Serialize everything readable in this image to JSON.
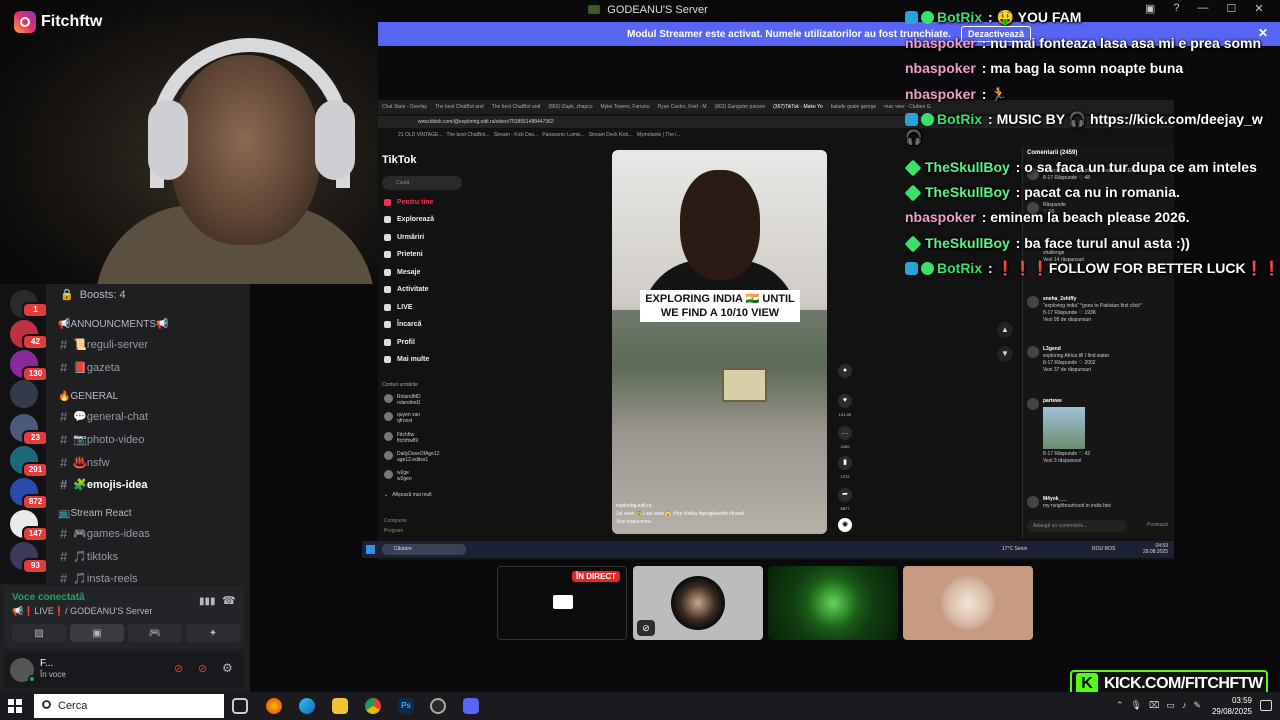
{
  "webcam": {
    "brand_name": "Fitchftw"
  },
  "window": {
    "title": "GODEANU'S Server"
  },
  "streamer_bar": {
    "message": "Modul Streamer este activat. Numele utilizatorilor au fost trunchiate.",
    "button": "Dezactivează"
  },
  "discord": {
    "boosts": "Boosts: 4",
    "server_badges": [
      "1",
      "42",
      "130",
      "23",
      "291",
      "872",
      "147",
      "93"
    ],
    "categories": [
      "📢ANNOUNCMENTS📢",
      "🔥GENERAL",
      "📺Stream React"
    ],
    "channels": [
      "📜reguli-server",
      "📕gazeta",
      "💬general-chat",
      "📷photo-video",
      "♨️nsfw",
      "🧩emojis-idea",
      "🎮games-ideas",
      "🎵tiktoks",
      "🎵insta-reels"
    ],
    "voice_status": "Voce conectată",
    "voice_server": "📢❗LIVE❗/ GODEANU'S Server",
    "user_name": "F...",
    "user_sub": "În voce"
  },
  "browser": {
    "tabs": [
      "Chat Stats - Overlay",
      "The best ChatBot and",
      "The best ChatBot and",
      "(863) iZapk, zhapco",
      "Myke Towers, Farruko",
      "Ryan Castro, Feid - M",
      "(863) Gangster paruon",
      "(367)TikTok - Make Yo",
      "balade goale george",
      "mac veer - Ciufare G"
    ],
    "url": "www.tiktok.com/@exploring.edit.ra/video/7538551488447362",
    "bookmarks": [
      "21 OLD VINTAGE...",
      "The best ChatBot...",
      "Stream - Kick Das...",
      "Panasonic Lumix...",
      "Stream Deck Kick...",
      "Mymotants | The i..."
    ],
    "tiktok_logo": "TikTok",
    "search_placeholder": "Caută",
    "nav": [
      "Pentru tine",
      "Explorează",
      "Urmăriri",
      "Prieteni",
      "Mesaje",
      "Activitate",
      "LIVE",
      "Încarcă",
      "Profil",
      "Mai multe"
    ],
    "following_header": "Conturi urmărite",
    "accounts": [
      {
        "name": "RolandMD",
        "handle": "rolandmd1"
      },
      {
        "name": "quyen van",
        "handle": "qfroost"
      },
      {
        "name": "Fitchftw",
        "handle": "fitchftw89"
      },
      {
        "name": "DailyDoseOfAge12",
        "handle": "age12.editss1"
      },
      {
        "name": "w2ge",
        "handle": "w2geo"
      }
    ],
    "show_more": "Afișează mai mult",
    "footer": [
      "Companie",
      "Program"
    ],
    "video_caption": "EXPLORING INDIA 🇮🇳 UNTIL WE FIND A 10/10 VIEW",
    "video_author": "exploring.edit.ra",
    "video_desc": "1st view 😨 Last view 😱 #fyp #india #googleearth #travel",
    "video_sound": "Vezi traducerea",
    "rail_counts": [
      "131.5K",
      "2459",
      "1272",
      "5877"
    ],
    "comments_header": "Comentarii (2459)",
    "comments": [
      {
        "user": "",
        "text": "U missed the right place in India. It's KERALA.",
        "meta": "8-17 Răspunde",
        "likes": "48"
      },
      {
        "user": "",
        "text": "",
        "meta": "Răspunde",
        "likes": "60"
      },
      {
        "user": "",
        "text": "challenge",
        "meta": "Vezi 14 răspunsuri",
        "likes": ""
      },
      {
        "user": "sneha_2shiffy",
        "text": "\"exploring india\" *goes to Pakistan first click*",
        "meta": "8-17 Răspunde",
        "likes": "193K"
      },
      {
        "user": "L3gend",
        "text": "exploring Africa till I find water",
        "meta": "8-17 Răspunde",
        "likes": "2002"
      },
      {
        "user": "partewe",
        "text": "",
        "meta": "8-17 Răspunde",
        "likes": "42"
      },
      {
        "user": "M4yok___",
        "text": "my neighbourhood in india btw",
        "meta": "",
        "likes": ""
      }
    ],
    "comments_replies": [
      "Vezi 95 de răspunsuri",
      "Vezi 37 de răspunsuri",
      "Vezi 3 răspunsuri"
    ],
    "comment_placeholder": "Adaugă un comentariu...",
    "comment_post": "Postează",
    "taskbar_search": "Căutare",
    "taskbar_lang": "ROU ROS",
    "taskbar_time": "04:59",
    "taskbar_date": "29.08.2025",
    "weather": "17°C Senin"
  },
  "tiles": {
    "live_badge": "ÎN DIRECT"
  },
  "chat": [
    {
      "user": "BotRix",
      "kind": "bot",
      "text": "🤑 YOU FAM"
    },
    {
      "user": "nbaspoker",
      "kind": "nba",
      "text": "nu mai fonteaza lasa asa mi e prea somn"
    },
    {
      "user": "nbaspoker",
      "kind": "nba",
      "text": "ma bag la somn noapte buna"
    },
    {
      "user": "nbaspoker",
      "kind": "nba",
      "text": "🏃"
    },
    {
      "user": "BotRix",
      "kind": "bot",
      "text": "MUSIC BY 🎧 https://kick.com/deejay_w 🎧"
    },
    {
      "user": "TheSkullBoy",
      "kind": "skull",
      "text": "o sa faca un tur dupa ce am inteles"
    },
    {
      "user": "TheSkullBoy",
      "kind": "skull",
      "text": "pacat ca nu in romania."
    },
    {
      "user": "nbaspoker",
      "kind": "nba",
      "text": "eminem la beach please 2026."
    },
    {
      "user": "TheSkullBoy",
      "kind": "skull",
      "text": "ba face turul anul asta :))"
    },
    {
      "user": "BotRix",
      "kind": "bot",
      "text": "❗❗❗FOLLOW FOR BETTER LUCK❗❗❗"
    }
  ],
  "kick": {
    "label": "KICK.COM/FITCHFTW"
  },
  "taskbar": {
    "search": "Cerca",
    "time": "03:59",
    "date": "29/08/2025"
  },
  "colors": {
    "discord_blurple": "#5865f2",
    "kick_green": "#53fc18",
    "tiktok_red": "#fe2c55",
    "voice_green": "#23a55a"
  }
}
